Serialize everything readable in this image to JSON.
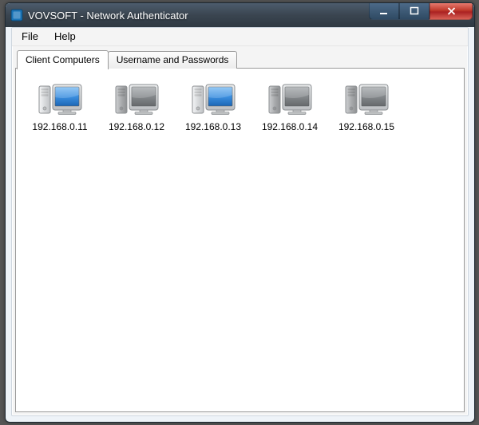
{
  "window": {
    "title": "VOVSOFT - Network Authenticator"
  },
  "menu": {
    "file": "File",
    "help": "Help"
  },
  "tabs": {
    "clients": "Client Computers",
    "creds": "Username and Passwords"
  },
  "computers": [
    {
      "ip": "192.168.0.11",
      "online": true
    },
    {
      "ip": "192.168.0.12",
      "online": false
    },
    {
      "ip": "192.168.0.13",
      "online": true
    },
    {
      "ip": "192.168.0.14",
      "online": false
    },
    {
      "ip": "192.168.0.15",
      "online": false
    }
  ]
}
